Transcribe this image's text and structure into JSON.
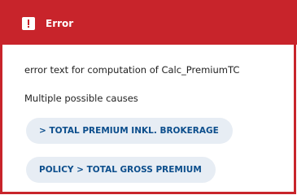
{
  "header": {
    "title": "Error",
    "icon": "exclamation-icon",
    "color": "#c8242b"
  },
  "body": {
    "error_text": "error text for computation of Calc_PremiumTC",
    "causes_label": "Multiple possible causes"
  },
  "causes": [
    {
      "label": "> TOTAL PREMIUM INKL. BROKERAGE"
    },
    {
      "label": "POLICY > TOTAL GROSS PREMIUM"
    }
  ]
}
